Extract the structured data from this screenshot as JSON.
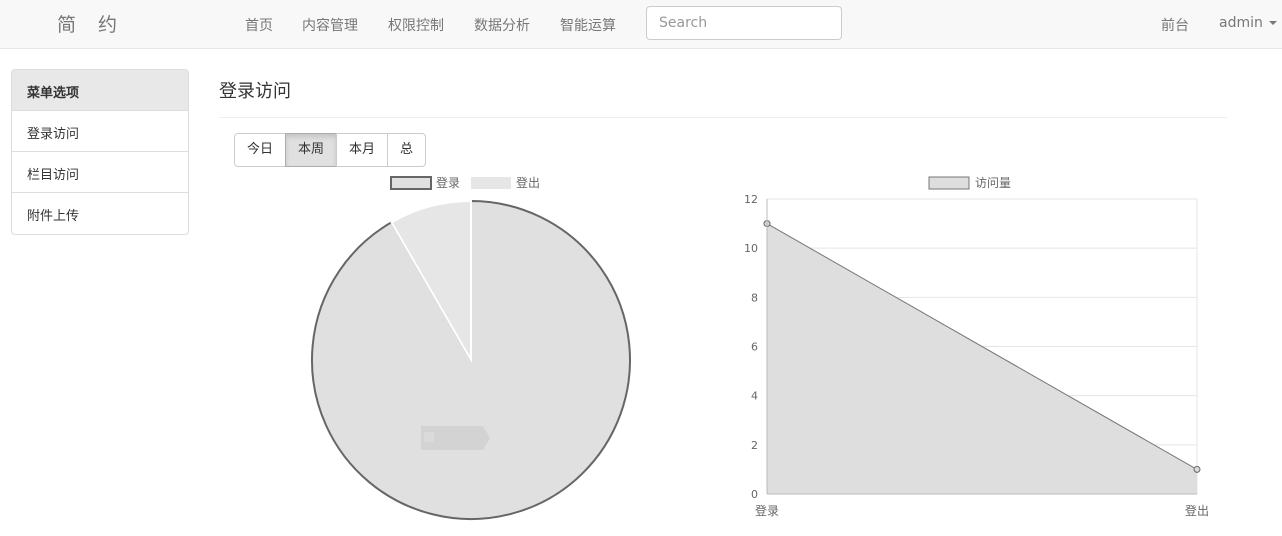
{
  "navbar": {
    "brand": "简 约",
    "links": [
      "首页",
      "内容管理",
      "权限控制",
      "数据分析",
      "智能运算"
    ],
    "search_placeholder": "Search",
    "right_link": "前台",
    "user": "admin"
  },
  "sidebar": {
    "header": "菜单选项",
    "items": [
      "登录访问",
      "栏目访问",
      "附件上传"
    ]
  },
  "main": {
    "title": "登录访问",
    "range_buttons": [
      "今日",
      "本周",
      "本月",
      "总"
    ],
    "active_range": "本周"
  },
  "colors": {
    "pie_login": "#e0e0e0",
    "pie_logout": "#e6e6e6",
    "pie_border": "#666666",
    "line_fill": "#dedede",
    "line_stroke": "#777777"
  },
  "chart_data": [
    {
      "type": "pie",
      "categories": [
        "登录",
        "登出"
      ],
      "values": [
        11,
        1
      ],
      "legend": "top"
    },
    {
      "type": "area",
      "categories": [
        "登录",
        "登出"
      ],
      "series": [
        {
          "name": "访问量",
          "values": [
            11,
            1
          ]
        }
      ],
      "ylim": [
        0,
        12
      ],
      "yticks": [
        0,
        2,
        4,
        6,
        8,
        10,
        12
      ],
      "grid": true,
      "legend": "top"
    }
  ]
}
